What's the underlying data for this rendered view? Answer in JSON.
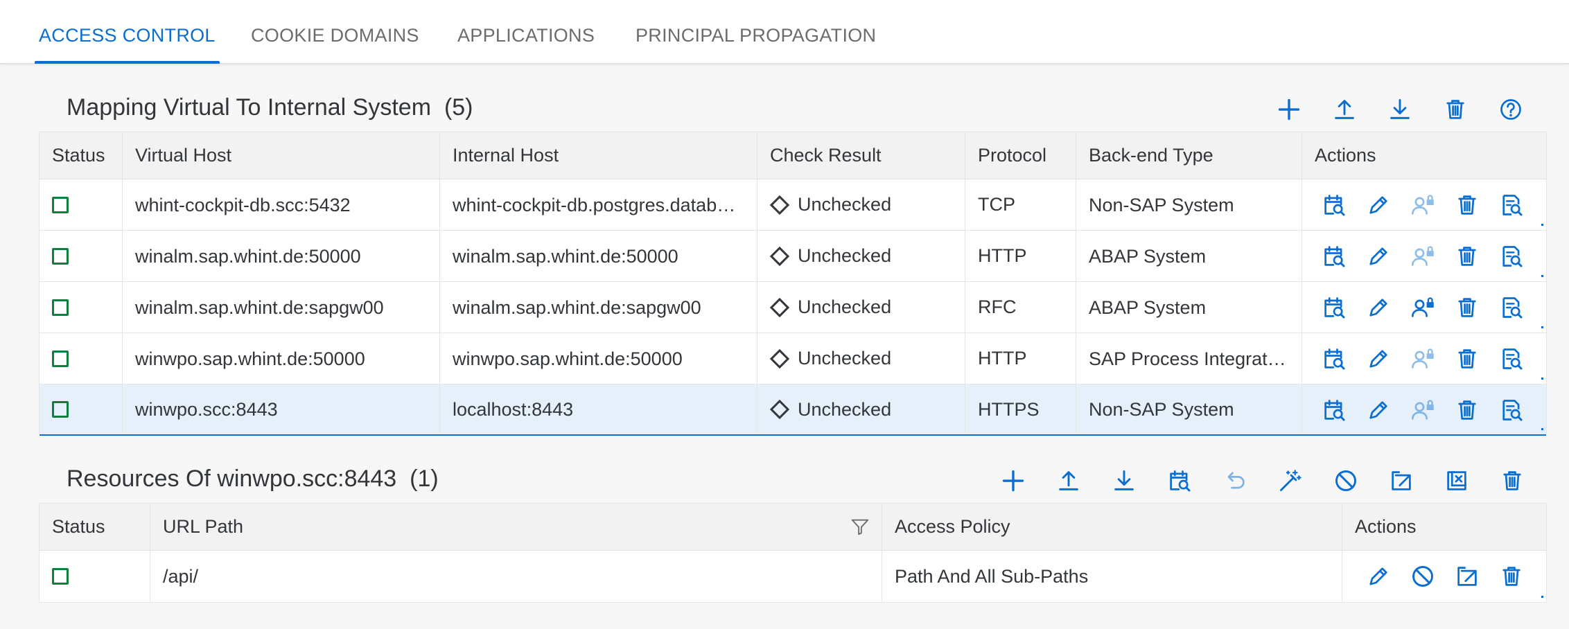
{
  "tabs": [
    {
      "label": "ACCESS CONTROL",
      "active": true
    },
    {
      "label": "COOKIE DOMAINS",
      "active": false
    },
    {
      "label": "APPLICATIONS",
      "active": false
    },
    {
      "label": "PRINCIPAL PROPAGATION",
      "active": false
    }
  ],
  "colors": {
    "accent": "#0a6ed1",
    "status_ok": "#107e3e",
    "selected_row": "#e5f0fa"
  },
  "mapping": {
    "title": "Mapping Virtual To Internal System",
    "count": "(5)",
    "toolbar_icons": [
      "add-icon",
      "upload-icon",
      "download-icon",
      "delete-icon",
      "help-icon"
    ],
    "columns": [
      "Status",
      "Virtual Host",
      "Internal Host",
      "Check Result",
      "Protocol",
      "Back-end Type",
      "Actions"
    ],
    "rows": [
      {
        "virtual_host": "whint-cockpit-db.scc:5432",
        "internal_host": "whint-cockpit-db.postgres.datab…",
        "check_result": "Unchecked",
        "protocol": "TCP",
        "backend_type": "Non-SAP System",
        "principal_enabled": false,
        "selected": false
      },
      {
        "virtual_host": "winalm.sap.whint.de:50000",
        "internal_host": "winalm.sap.whint.de:50000",
        "check_result": "Unchecked",
        "protocol": "HTTP",
        "backend_type": "ABAP System",
        "principal_enabled": false,
        "selected": false
      },
      {
        "virtual_host": "winalm.sap.whint.de:sapgw00",
        "internal_host": "winalm.sap.whint.de:sapgw00",
        "check_result": "Unchecked",
        "protocol": "RFC",
        "backend_type": "ABAP System",
        "principal_enabled": true,
        "selected": false
      },
      {
        "virtual_host": "winwpo.sap.whint.de:50000",
        "internal_host": "winwpo.sap.whint.de:50000",
        "check_result": "Unchecked",
        "protocol": "HTTP",
        "backend_type": "SAP Process Integrat…",
        "principal_enabled": false,
        "selected": false
      },
      {
        "virtual_host": "winwpo.scc:8443",
        "internal_host": "localhost:8443",
        "check_result": "Unchecked",
        "protocol": "HTTPS",
        "backend_type": "Non-SAP System",
        "principal_enabled": false,
        "selected": true
      }
    ],
    "row_action_icons": [
      "check-availability-icon",
      "edit-icon",
      "principal-lock-icon",
      "delete-icon",
      "inspect-icon"
    ]
  },
  "resources": {
    "title": "Resources Of winwpo.scc:8443",
    "count": "(1)",
    "toolbar_icons": [
      "add-icon",
      "upload-icon",
      "download-icon",
      "check-availability-icon",
      "undo-icon",
      "magic-wand-icon",
      "disable-icon",
      "open-external-icon",
      "close-box-icon",
      "delete-icon"
    ],
    "columns": [
      "Status",
      "URL Path",
      "Access Policy",
      "Actions"
    ],
    "rows": [
      {
        "url_path": "/api/",
        "access_policy": "Path And All Sub-Paths"
      }
    ],
    "row_action_icons": [
      "edit-icon",
      "disable-icon",
      "open-external-icon",
      "delete-icon",
      "inspect-icon"
    ]
  }
}
